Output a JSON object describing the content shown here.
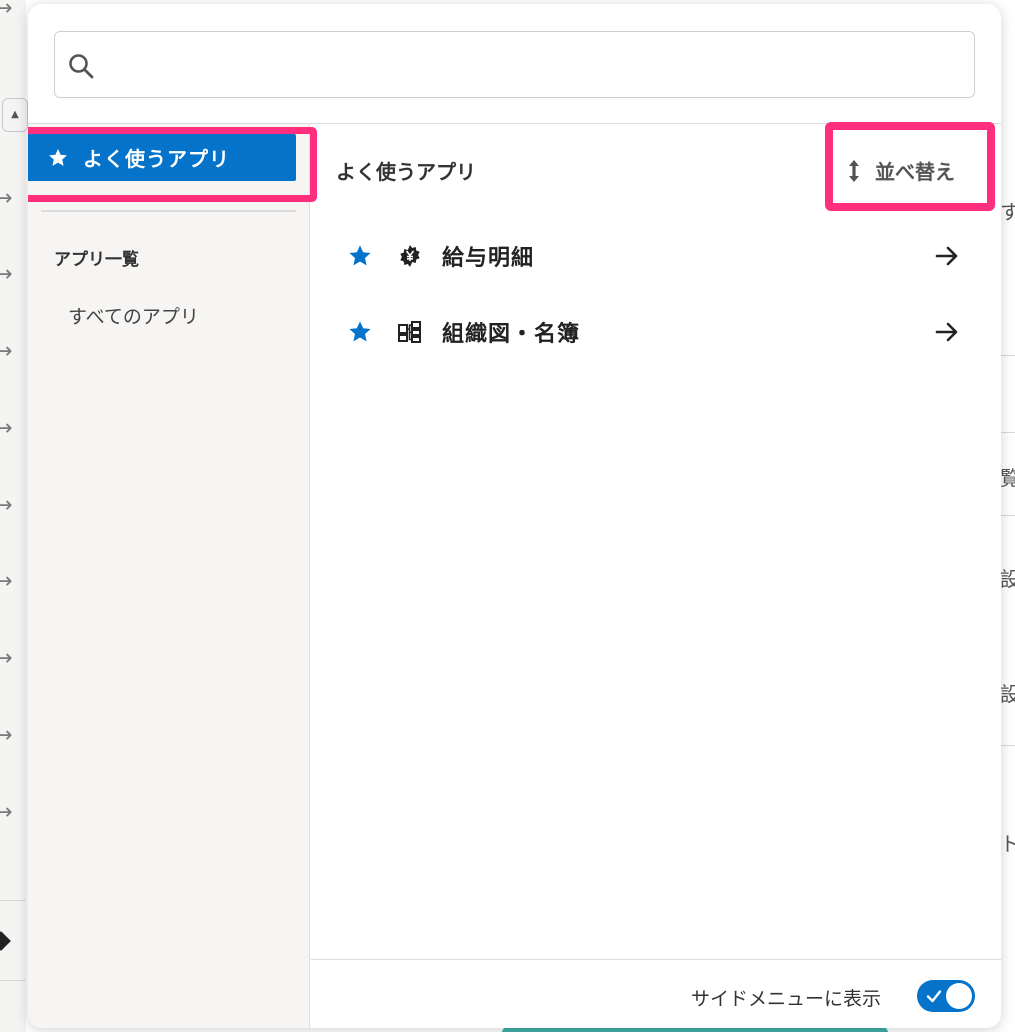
{
  "search": {
    "value": "",
    "placeholder": ""
  },
  "sidebar": {
    "active_item": {
      "label": "よく使うアプリ",
      "icon": "star-icon"
    },
    "section_heading": "アプリ一覧",
    "items": [
      {
        "label": "すべてのアプリ"
      }
    ]
  },
  "main": {
    "title": "よく使うアプリ",
    "sort_label": "並べ替え",
    "apps": [
      {
        "name": "給与明細",
        "icon": "yen-gear-icon",
        "favorite": true
      },
      {
        "name": "組織図・名簿",
        "icon": "org-chart-icon",
        "favorite": true
      }
    ]
  },
  "footer": {
    "toggle_label": "サイドメニューに表示",
    "toggle_on": true
  },
  "background": {
    "right_fragments": [
      "す",
      "覧",
      "設",
      "設",
      "ト"
    ]
  },
  "colors": {
    "accent": "#0473c9",
    "highlight": "#ff2f7e",
    "teal": "#1e9e96"
  }
}
